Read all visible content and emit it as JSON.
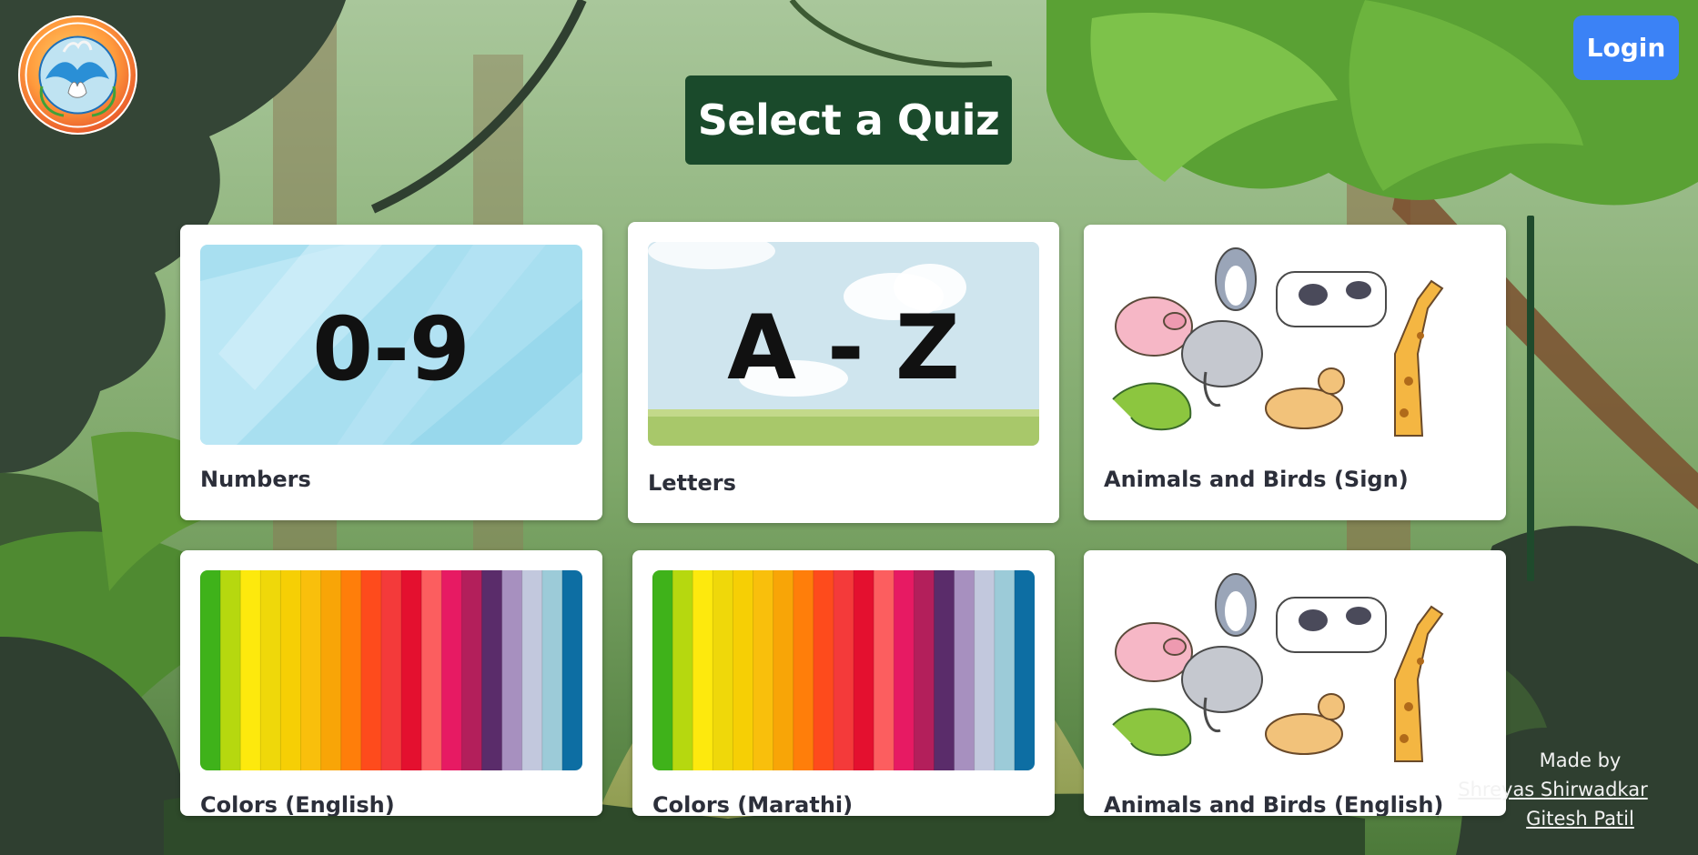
{
  "header": {
    "title": "Select a Quiz",
    "login_label": "Login",
    "logo_icon": "institution-logo-icon"
  },
  "quizzes": [
    {
      "label": "Numbers",
      "thumb_text": "0-9",
      "thumb_icon": "numbers-thumbnail-icon"
    },
    {
      "label": "Letters",
      "thumb_text": "A - Z",
      "thumb_icon": "letters-thumbnail-icon"
    },
    {
      "label": "Animals and Birds (Sign)",
      "thumb_icon": "animals-thumbnail-icon"
    },
    {
      "label": "Colors (English)",
      "thumb_icon": "color-strips-thumbnail-icon"
    },
    {
      "label": "Colors (Marathi)",
      "thumb_icon": "color-strips-thumbnail-icon"
    },
    {
      "label": "Animals and Birds (English)",
      "thumb_icon": "animals-thumbnail-icon"
    }
  ],
  "footer": {
    "made_by": "Made by",
    "authors": [
      "Shreyas Shirwadkar",
      "Gitesh Patil"
    ]
  },
  "colors": {
    "title_bg": "#1a4a2b",
    "login_bg": "#3b82f6",
    "card_bg": "#ffffff",
    "strip_colors": [
      "#3fb21a",
      "#b6d80f",
      "#fde90d",
      "#efd80a",
      "#f6cf05",
      "#f9bf0c",
      "#f8a507",
      "#ff7e0a",
      "#fe4b1c",
      "#f43a3a",
      "#e4102f",
      "#fc5e5f",
      "#e71a63",
      "#b31f5b",
      "#5a2c6a",
      "#a790bf",
      "#c2c8dd",
      "#9ccbd8",
      "#0d6ea3"
    ]
  }
}
